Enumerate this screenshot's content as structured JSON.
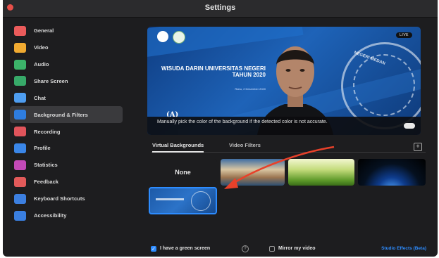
{
  "window": {
    "title": "Settings"
  },
  "sidebar": {
    "items": [
      {
        "label": "General",
        "icon": "gear-icon",
        "color": "#ea5b5b"
      },
      {
        "label": "Video",
        "icon": "video-icon",
        "color": "#f0aa31"
      },
      {
        "label": "Audio",
        "icon": "headphones-icon",
        "color": "#3cb36a"
      },
      {
        "label": "Share Screen",
        "icon": "share-screen-icon",
        "color": "#37a969"
      },
      {
        "label": "Chat",
        "icon": "chat-icon",
        "color": "#4e9df0"
      },
      {
        "label": "Background & Filters",
        "icon": "background-icon",
        "color": "#2e7de0",
        "active": true
      },
      {
        "label": "Recording",
        "icon": "record-icon",
        "color": "#e0545b"
      },
      {
        "label": "Profile",
        "icon": "profile-icon",
        "color": "#3a86e8"
      },
      {
        "label": "Statistics",
        "icon": "statistics-icon",
        "color": "#c34ab8"
      },
      {
        "label": "Feedback",
        "icon": "feedback-icon",
        "color": "#e15a5a"
      },
      {
        "label": "Keyboard Shortcuts",
        "icon": "keyboard-icon",
        "color": "#3c7fe0"
      },
      {
        "label": "Accessibility",
        "icon": "accessibility-icon",
        "color": "#3a7fe0"
      }
    ]
  },
  "preview": {
    "caption": "Manually pick the color of the background if the detected color is not accurate.",
    "background_text": "WISUDA DARIN UNIVERSITAS NEGERI TAHUN 2020",
    "background_subtext": "Rabu, 2 Desember 2020",
    "seal_text": "NEGERI MEDAN",
    "badge_text": "LIVE",
    "letter_mark": "(A)"
  },
  "tabs": [
    {
      "label": "Virtual Backgrounds",
      "active": true
    },
    {
      "label": "Video Filters",
      "active": false
    }
  ],
  "backgrounds": {
    "none_label": "None"
  },
  "footer": {
    "green_screen_label": "I have a green screen",
    "green_screen_checked": true,
    "mirror_label": "Mirror my video",
    "mirror_checked": false,
    "studio_effects_label": "Studio Effects (Beta)"
  },
  "colors": {
    "accent": "#2d8cff",
    "annotation_arrow": "#e8412a"
  }
}
